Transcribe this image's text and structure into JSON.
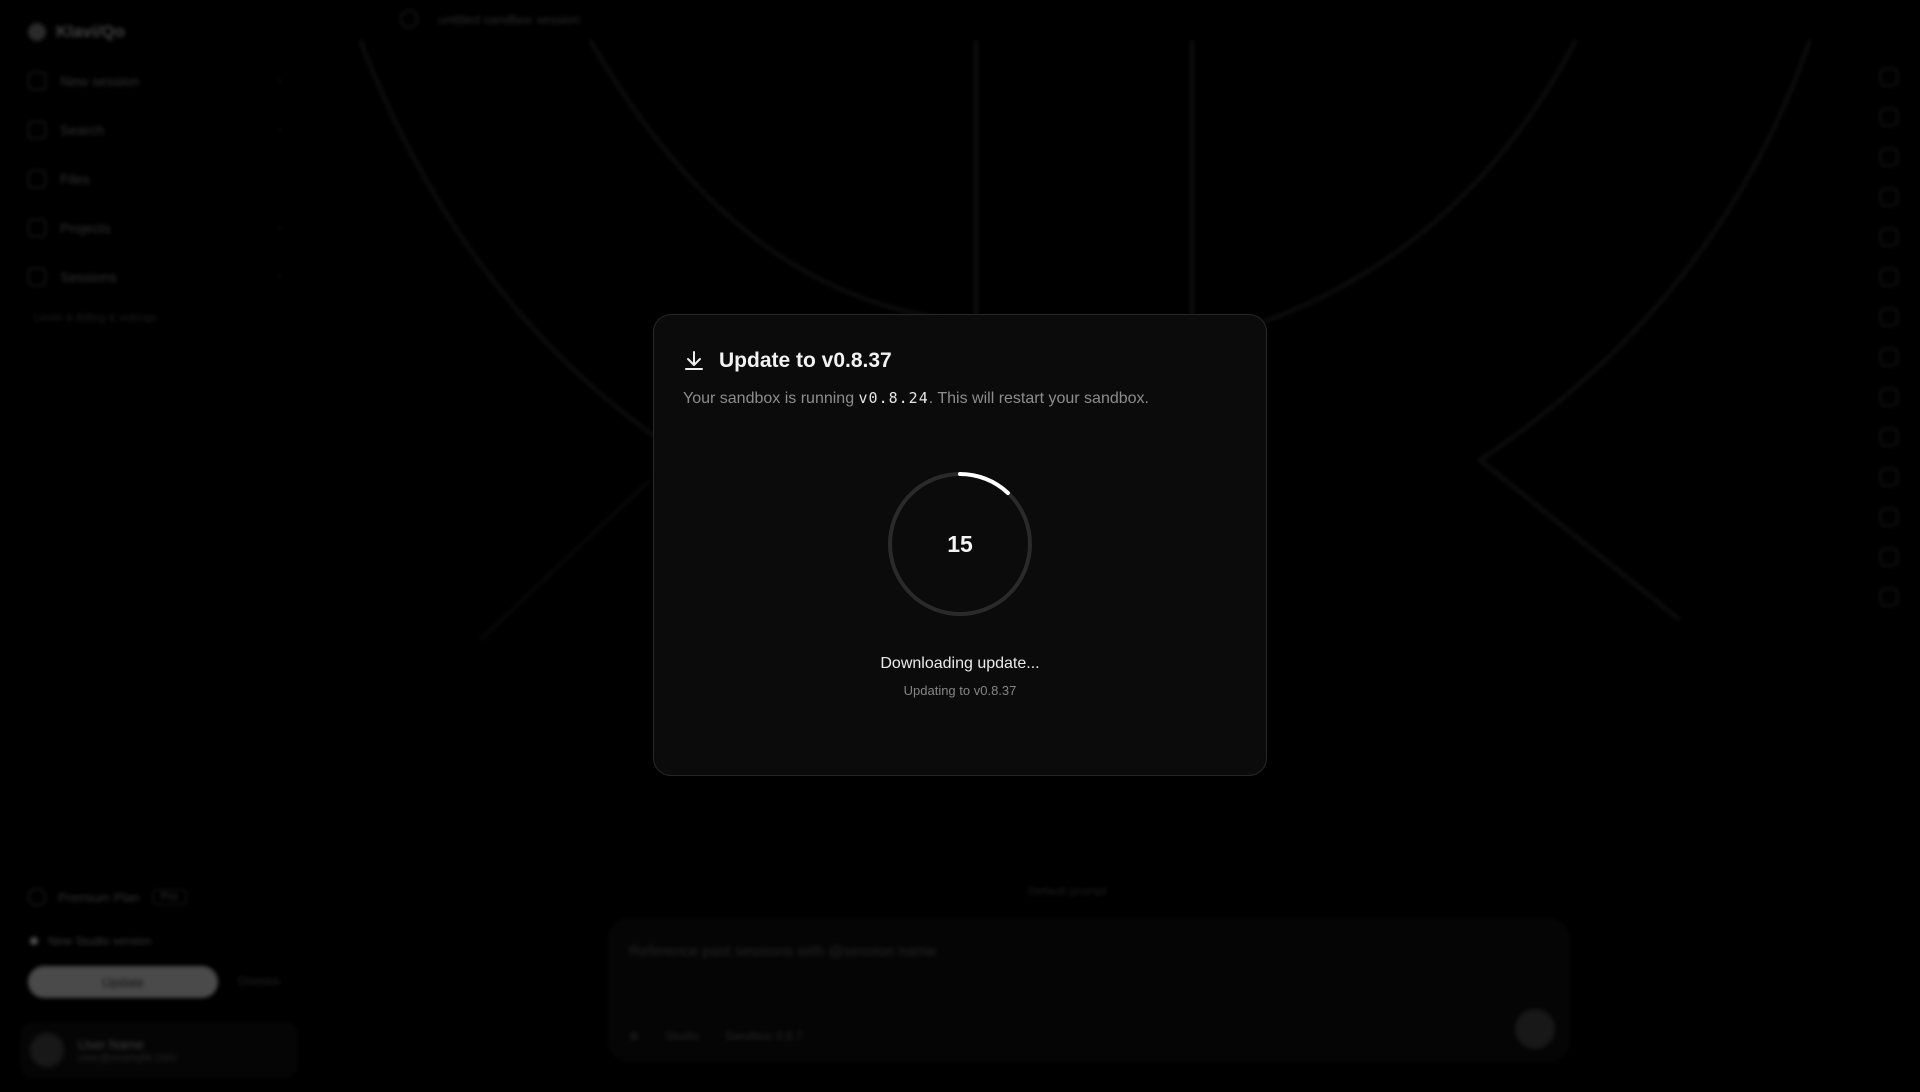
{
  "sidebar": {
    "brand": "Klavi/Qo",
    "items": [
      {
        "label": "New session"
      },
      {
        "label": "Search"
      },
      {
        "label": "Files"
      },
      {
        "label": "Projects"
      },
      {
        "label": "Sessions"
      }
    ],
    "sub_text": "Limits & Billing & settings",
    "plan_label": "Premium Plan",
    "plan_badge": "Pro",
    "new_update_label": "New Studio version",
    "update_button": "Update",
    "later_button": "Dismiss",
    "user_name": "User Name",
    "user_sub": "user@example.com"
  },
  "topbar": {
    "breadcrumb": "untitled sandbox session"
  },
  "composer": {
    "above": "Default prompt",
    "placeholder": "Reference past sessions with @session name",
    "mode": "Studio",
    "model": "Sandbox 0.8.7"
  },
  "modal": {
    "icon": "download-icon",
    "title": "Update to v0.8.37",
    "desc_before": "Your sandbox is running ",
    "current_version": "v0.8.24",
    "desc_after": ". This will restart your sandbox.",
    "countdown": "15",
    "progress": 0.12,
    "status": "Downloading update...",
    "status_sub": "Updating to v0.8.37"
  },
  "colors": {
    "background": "#000000",
    "modal_bg": "#0b0b0b",
    "ring_track": "#2a2a2a",
    "ring_progress": "#ffffff"
  }
}
